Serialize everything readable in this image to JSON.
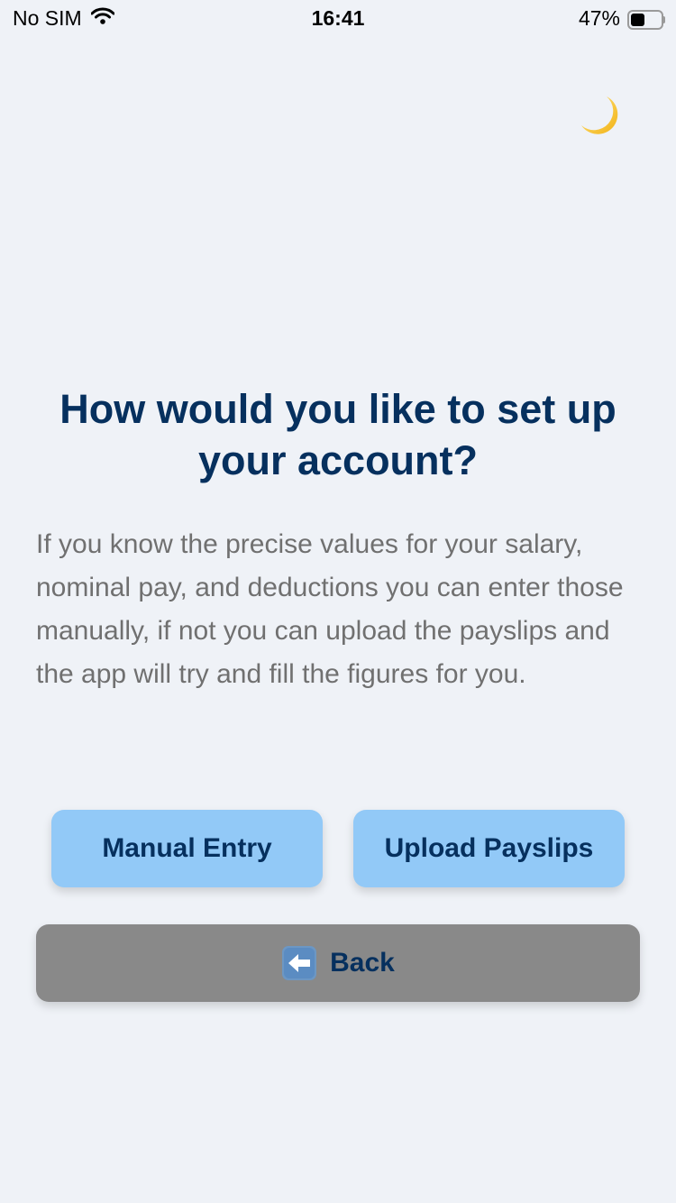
{
  "status_bar": {
    "carrier": "No SIM",
    "time": "16:41",
    "battery_percent": "47%",
    "battery_level": 0.47,
    "icons": [
      "wifi-icon",
      "battery-icon"
    ]
  },
  "theme_toggle": {
    "icon": "crescent-moon-icon",
    "color": "#f6c431"
  },
  "setup": {
    "title": "How would you like to set up your account?",
    "description": "If you know the precise values for your salary, nominal pay, and deductions you can enter those manually, if not you can upload the payslips and the app will try and fill the figures for you."
  },
  "buttons": {
    "manual_entry": "Manual Entry",
    "upload_payslips": "Upload Payslips",
    "back": "Back",
    "back_icon": "left-arrow-icon"
  },
  "colors": {
    "background": "#eff2f7",
    "title": "#06305e",
    "description": "#707070",
    "primary_button": "#92c9f7",
    "back_button": "#898989"
  }
}
